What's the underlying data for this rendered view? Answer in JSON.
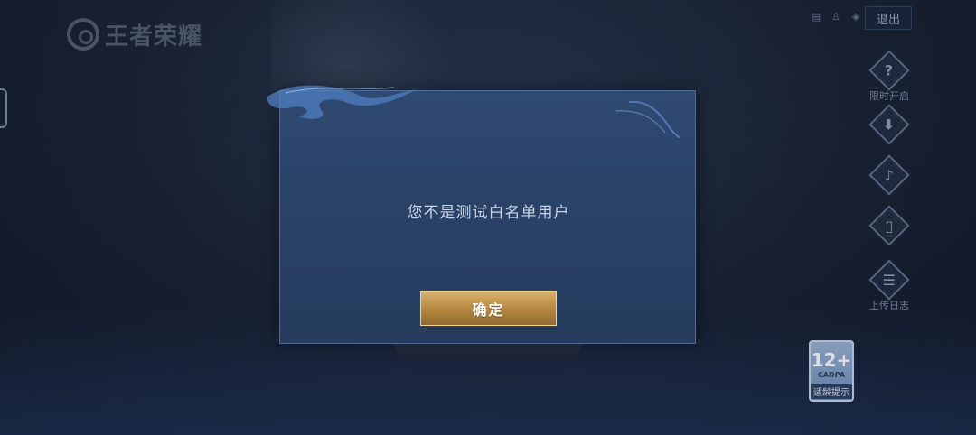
{
  "app": {
    "logo_text": "王者荣耀"
  },
  "header": {
    "icons": [
      "document-icon",
      "person-icon",
      "shield-icon"
    ],
    "exit_label": "退出"
  },
  "sidebar": {
    "items": [
      {
        "icon": "help-icon",
        "glyph": "?",
        "label": "限时开启"
      },
      {
        "icon": "download-icon",
        "glyph": "⬇",
        "label": ""
      },
      {
        "icon": "sound-icon",
        "glyph": "🔊",
        "label": ""
      },
      {
        "icon": "phone-icon",
        "glyph": "▯",
        "label": ""
      },
      {
        "icon": "clipboard-icon",
        "glyph": "☰",
        "label": "上传日志"
      }
    ]
  },
  "dialog": {
    "message": "您不是测试白名单用户",
    "confirm_label": "确定"
  },
  "age_rating": {
    "age": "12+",
    "org": "CADPA",
    "tip": "适龄提示"
  },
  "colors": {
    "background": "#1a2436",
    "dialog": "#2a4268",
    "confirm_button": "#b88a42"
  }
}
